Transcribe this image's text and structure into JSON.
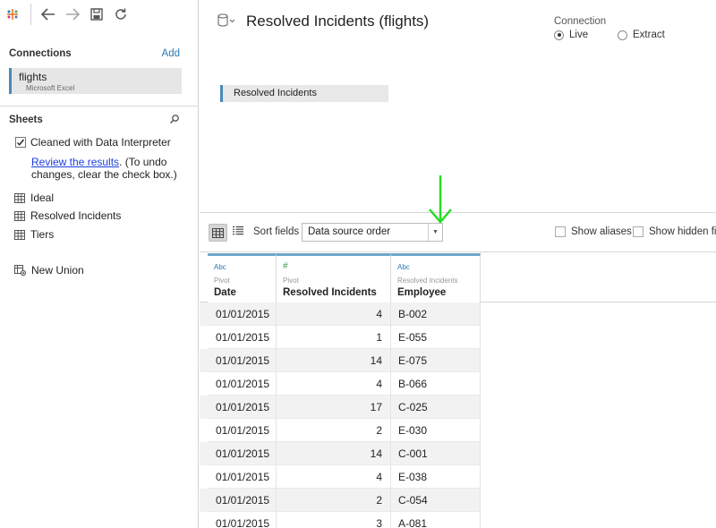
{
  "toolbar": {
    "logo": "tableau-logo-icon",
    "back": "back-arrow-icon",
    "forward": "forward-arrow-icon",
    "save": "save-icon",
    "refresh": "refresh-icon"
  },
  "connections": {
    "heading": "Connections",
    "add_label": "Add",
    "items": [
      {
        "name": "flights",
        "type": "Microsoft Excel"
      }
    ]
  },
  "sheets": {
    "heading": "Sheets",
    "interpreter_label": "Cleaned with Data Interpreter",
    "interpreter_checked": true,
    "review_link": "Review the results",
    "review_note": ". (To undo changes, clear the check box.)",
    "items": [
      {
        "label": "Ideal"
      },
      {
        "label": "Resolved Incidents"
      },
      {
        "label": "Tiers"
      }
    ],
    "new_union": "New Union"
  },
  "datasource": {
    "title": "Resolved Incidents (flights)",
    "connection_label": "Connection",
    "live_label": "Live",
    "extract_label": "Extract",
    "selected": "Live",
    "canvas_table": "Resolved Incidents"
  },
  "grid_bar": {
    "sort_label": "Sort fields",
    "sort_value": "Data source order",
    "show_aliases": "Show aliases",
    "show_hidden": "Show hidden fie"
  },
  "columns": [
    {
      "type": "Abc",
      "source": "Pivot",
      "name": "Date"
    },
    {
      "type": "#",
      "source": "Pivot",
      "name": "Resolved Incidents"
    },
    {
      "type": "Abc",
      "source": "Resolved Incidents",
      "name": "Employee"
    }
  ],
  "rows": [
    {
      "date": "01/01/2015",
      "resolved": "4",
      "employee": "B-002"
    },
    {
      "date": "01/01/2015",
      "resolved": "1",
      "employee": "E-055"
    },
    {
      "date": "01/01/2015",
      "resolved": "14",
      "employee": "E-075"
    },
    {
      "date": "01/01/2015",
      "resolved": "4",
      "employee": "B-066"
    },
    {
      "date": "01/01/2015",
      "resolved": "17",
      "employee": "C-025"
    },
    {
      "date": "01/01/2015",
      "resolved": "2",
      "employee": "E-030"
    },
    {
      "date": "01/01/2015",
      "resolved": "14",
      "employee": "C-001"
    },
    {
      "date": "01/01/2015",
      "resolved": "4",
      "employee": "E-038"
    },
    {
      "date": "01/01/2015",
      "resolved": "2",
      "employee": "C-054"
    },
    {
      "date": "01/01/2015",
      "resolved": "3",
      "employee": "A-081"
    }
  ],
  "annotation": {
    "arrow_color": "#22dd22"
  }
}
